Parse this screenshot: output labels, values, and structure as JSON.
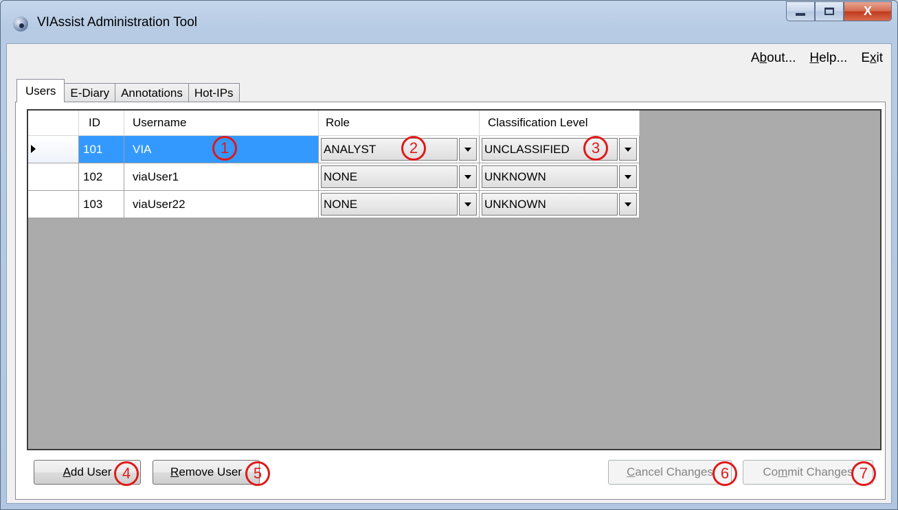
{
  "window": {
    "title": "VIAssist Administration Tool",
    "close_glyph": "X"
  },
  "menu": {
    "about": {
      "pre": "A",
      "key": "b",
      "post": "out..."
    },
    "help": {
      "pre": "",
      "key": "H",
      "post": "elp..."
    },
    "exit": {
      "pre": "E",
      "key": "x",
      "post": "it"
    }
  },
  "tabs": [
    "Users",
    "E-Diary",
    "Annotations",
    "Hot-IPs"
  ],
  "grid": {
    "columns": [
      "ID",
      "Username",
      "Role",
      "Classification Level"
    ],
    "rows": [
      {
        "id": "101",
        "username": "VIA",
        "role": "ANALYST",
        "classification": "UNCLASSIFIED",
        "selected": true
      },
      {
        "id": "102",
        "username": "viaUser1",
        "role": "NONE",
        "classification": "UNKNOWN",
        "selected": false
      },
      {
        "id": "103",
        "username": "viaUser22",
        "role": "NONE",
        "classification": "UNKNOWN",
        "selected": false
      }
    ]
  },
  "buttons": {
    "add_user": {
      "key": "A",
      "rest": "dd User",
      "enabled": true
    },
    "remove_user": {
      "key": "R",
      "rest": "emove User",
      "enabled": true
    },
    "cancel_changes": {
      "key": "C",
      "rest": "ancel Changes",
      "enabled": false
    },
    "commit_changes": {
      "pre": "Co",
      "key": "m",
      "rest": "mit Changes",
      "enabled": false
    }
  },
  "markers": [
    "1",
    "2",
    "3",
    "4",
    "5",
    "6",
    "7"
  ],
  "colors": {
    "selection": "#3399ff",
    "marker": "#e01818",
    "grid_background": "#ababab"
  }
}
